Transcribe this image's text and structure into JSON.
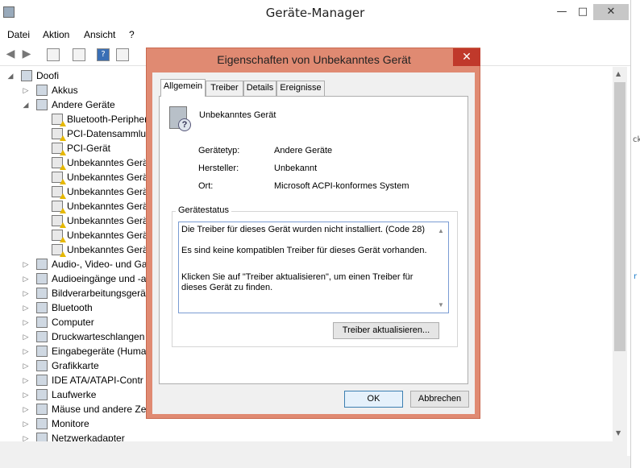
{
  "window": {
    "title": "Geräte-Manager",
    "minimize": "—",
    "maximize": "□",
    "close": "✕"
  },
  "menu": [
    "Datei",
    "Aktion",
    "Ansicht",
    "?"
  ],
  "tree": {
    "root": "Doofi",
    "items": [
      {
        "label": "Akkus",
        "level": 1,
        "expander": "▷",
        "icon": "battery-icon"
      },
      {
        "label": "Andere Geräte",
        "level": 1,
        "expander": "◢",
        "icon": "unknown-devices-icon"
      },
      {
        "label": "Bluetooth-Peripher",
        "level": 2,
        "icon": "warning-device-icon"
      },
      {
        "label": "PCI-Datensammlur",
        "level": 2,
        "icon": "warning-device-icon"
      },
      {
        "label": "PCI-Gerät",
        "level": 2,
        "icon": "warning-device-icon"
      },
      {
        "label": "Unbekanntes Gerät",
        "level": 2,
        "icon": "warning-device-icon"
      },
      {
        "label": "Unbekanntes Gerät",
        "level": 2,
        "icon": "warning-device-icon"
      },
      {
        "label": "Unbekanntes Gerät",
        "level": 2,
        "icon": "warning-device-icon"
      },
      {
        "label": "Unbekanntes Gerät",
        "level": 2,
        "icon": "warning-device-icon"
      },
      {
        "label": "Unbekanntes Gerät",
        "level": 2,
        "icon": "warning-device-icon"
      },
      {
        "label": "Unbekanntes Gerät",
        "level": 2,
        "icon": "warning-device-icon"
      },
      {
        "label": "Unbekanntes Gerät",
        "level": 2,
        "icon": "warning-device-icon"
      },
      {
        "label": "Audio-, Video- und Ga",
        "level": 1,
        "expander": "▷",
        "icon": "audio-icon"
      },
      {
        "label": "Audioeingänge und -a",
        "level": 1,
        "expander": "▷",
        "icon": "audio-input-icon"
      },
      {
        "label": "Bildverarbeitungsgerät",
        "level": 1,
        "expander": "▷",
        "icon": "camera-icon"
      },
      {
        "label": "Bluetooth",
        "level": 1,
        "expander": "▷",
        "icon": "bluetooth-icon"
      },
      {
        "label": "Computer",
        "level": 1,
        "expander": "▷",
        "icon": "computer-icon"
      },
      {
        "label": "Druckwarteschlangen",
        "level": 1,
        "expander": "▷",
        "icon": "printer-icon"
      },
      {
        "label": "Eingabegeräte (Human",
        "level": 1,
        "expander": "▷",
        "icon": "input-device-icon"
      },
      {
        "label": "Grafikkarte",
        "level": 1,
        "expander": "▷",
        "icon": "display-adapter-icon"
      },
      {
        "label": "IDE ATA/ATAPI-Contr",
        "level": 1,
        "expander": "▷",
        "icon": "ide-icon"
      },
      {
        "label": "Laufwerke",
        "level": 1,
        "expander": "▷",
        "icon": "drive-icon"
      },
      {
        "label": "Mäuse und andere Zei",
        "level": 1,
        "expander": "▷",
        "icon": "mouse-icon"
      },
      {
        "label": "Monitore",
        "level": 1,
        "expander": "▷",
        "icon": "monitor-icon"
      },
      {
        "label": "Netzwerkadapter",
        "level": 1,
        "expander": "▷",
        "icon": "network-icon"
      }
    ]
  },
  "right_fragments": [
    "ck",
    "r"
  ],
  "dialog": {
    "title": "Eigenschaften von Unbekanntes Gerät",
    "close": "✕",
    "tabs": [
      "Allgemein",
      "Treiber",
      "Details",
      "Ereignisse"
    ],
    "device_name": "Unbekanntes Gerät",
    "props": [
      {
        "label": "Gerätetyp:",
        "value": "Andere Geräte"
      },
      {
        "label": "Hersteller:",
        "value": "Unbekannt"
      },
      {
        "label": "Ort:",
        "value": "Microsoft ACPI-konformes System"
      }
    ],
    "status_group_title": "Gerätestatus",
    "status_text": [
      "Die Treiber für dieses Gerät wurden nicht installiert. (Code 28)",
      "Es sind keine kompatiblen Treiber für dieses Gerät vorhanden.",
      "Klicken Sie auf \"Treiber aktualisieren\", um einen Treiber für dieses Gerät zu finden."
    ],
    "update_driver_button": "Treiber aktualisieren...",
    "ok_button": "OK",
    "cancel_button": "Abbrechen"
  }
}
